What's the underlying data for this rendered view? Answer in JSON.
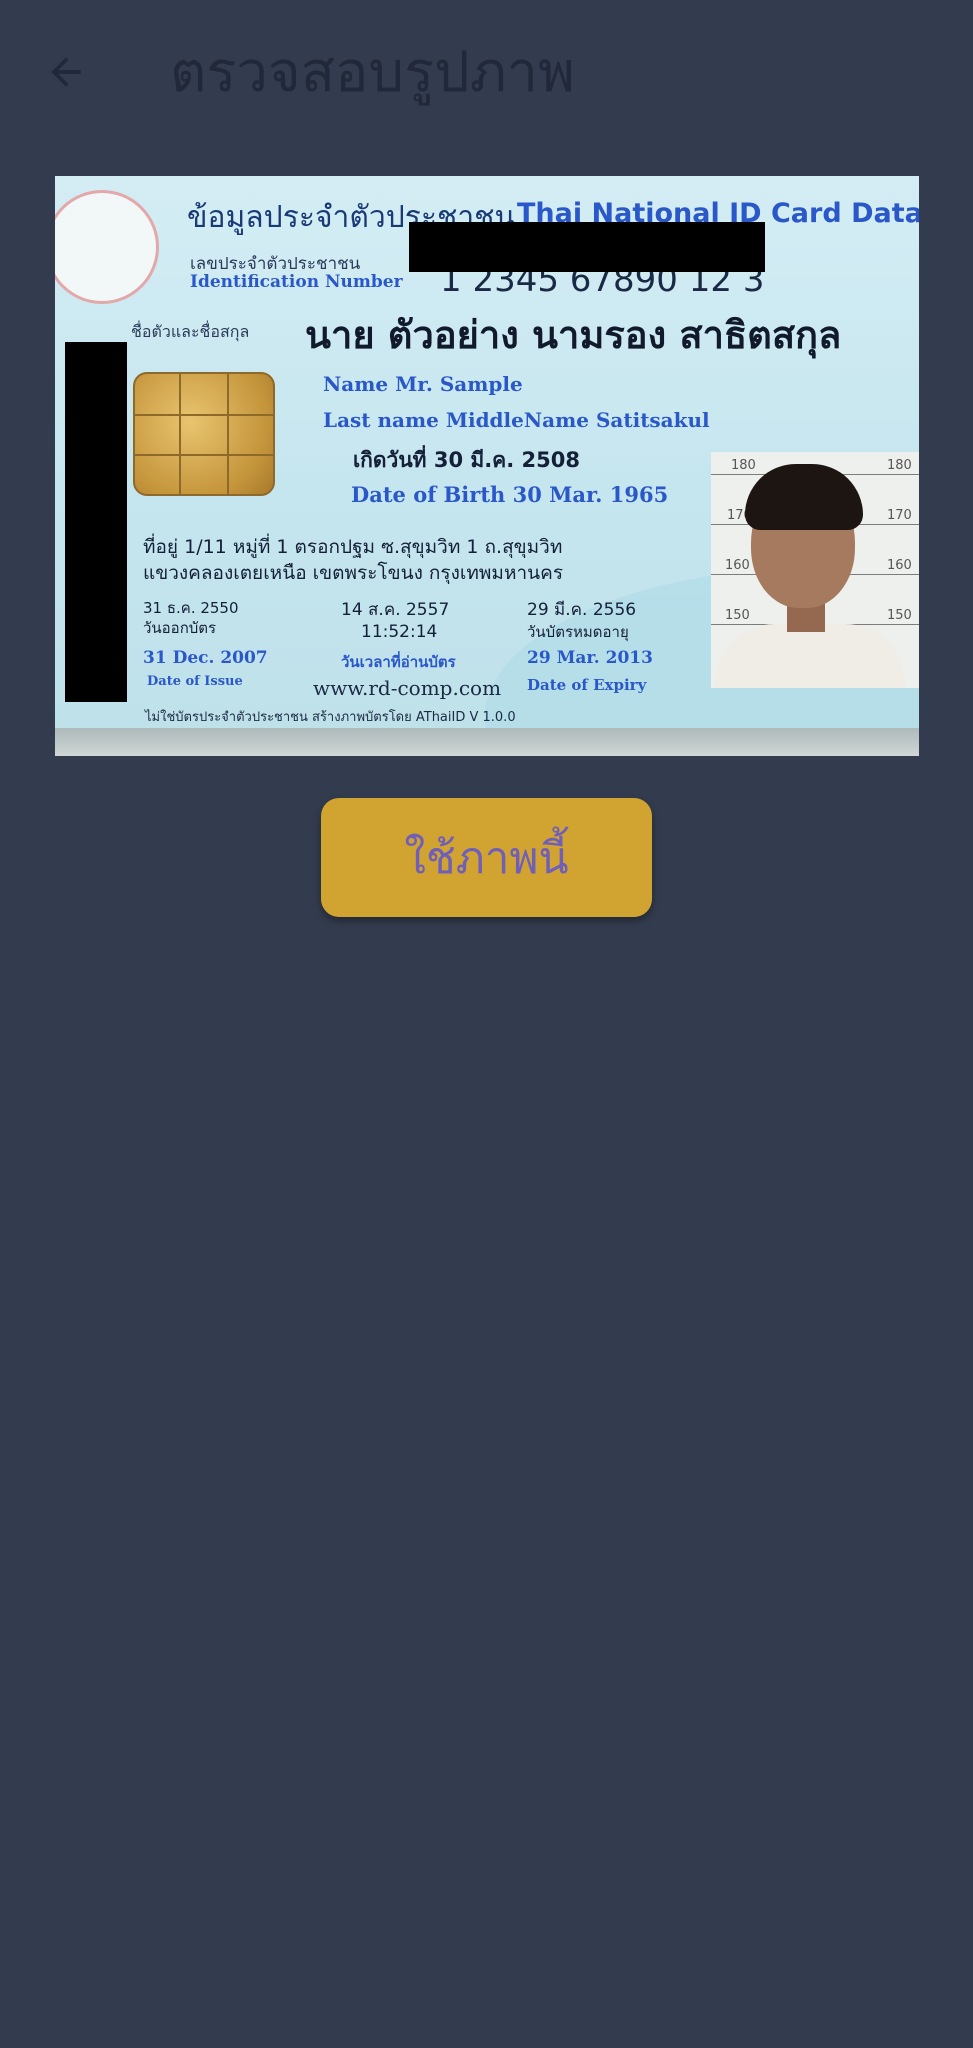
{
  "appbar": {
    "title": "ตรวจสอบรูปภาพ",
    "back_icon": "arrow-left-icon"
  },
  "card": {
    "header_th": "ข้อมูลประจำตัวประชาชน",
    "header_en": "Thai National ID Card Data",
    "id_label_th": "เลขประจำตัวประชาชน",
    "id_label_en": "Identification Number",
    "id_number": "1 2345 67890 12 3",
    "name_label_th": "ชื่อตัวและชื่อสกุล",
    "name_th": "นาย ตัวอย่าง นามรอง สาธิตสกุล",
    "name_en": "Name  Mr. Sample",
    "last_name_en": "Last name  MiddleName Satitsakul",
    "dob_th": "เกิดวันที่  30 มี.ค. 2508",
    "dob_en": "Date of Birth  30 Mar. 1965",
    "address_line1": "ที่อยู่   1/11 หมู่ที่ 1 ตรอกปฐม ซ.สุขุมวิท 1 ถ.สุขุมวิท",
    "address_line2": "แขวงคลองเตยเหนือ เขตพระโขนง กรุงเทพมหานคร",
    "issue_date_th": "31 ธ.ค. 2550",
    "issue_label_th": "วันออกบัตร",
    "issue_date_en": "31 Dec. 2007",
    "issue_label_en": "Date of Issue",
    "read_date": "14 ส.ค. 2557",
    "read_time": "11:52:14",
    "read_label_th": "วันเวลาที่อ่านบัตร",
    "expiry_date_th": "29 มี.ค. 2556",
    "expiry_label_th": "วันบัตรหมดอายุ",
    "expiry_date_en": "29 Mar. 2013",
    "expiry_label_en": "Date of Expiry",
    "url": "www.rd-comp.com",
    "footer": "ไม่ใช่บัตรประจำตัวประชาชน สร้างภาพบัตรโดย AThaiID V 1.0.0",
    "photo_scale": [
      "180",
      "170",
      "160",
      "150"
    ],
    "photo_scale_right": [
      "180",
      "170",
      "160",
      "150"
    ]
  },
  "actions": {
    "use_photo_label": "ใช้ภาพนี้"
  }
}
